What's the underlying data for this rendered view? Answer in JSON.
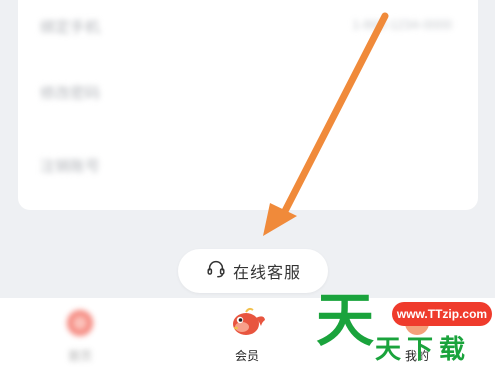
{
  "settings": {
    "rows": [
      {
        "label": "绑定手机",
        "value": "1-860-1234-0000"
      },
      {
        "label": "修改密码",
        "value": ""
      },
      {
        "label": "注销账号",
        "value": ""
      }
    ]
  },
  "customer_service": {
    "label": "在线客服",
    "icon": "headset-icon"
  },
  "tabbar": {
    "home_label": "首页",
    "member_label": "会员",
    "mine_label": "我的"
  },
  "watermark": {
    "badge": "www.TTzip.com",
    "big": "天",
    "small": "天下载"
  },
  "colors": {
    "background": "#eef0f3",
    "card": "#ffffff",
    "arrow": "#f08a3a",
    "watermark_green": "#1aa33c",
    "watermark_red": "#ef3b2c"
  }
}
